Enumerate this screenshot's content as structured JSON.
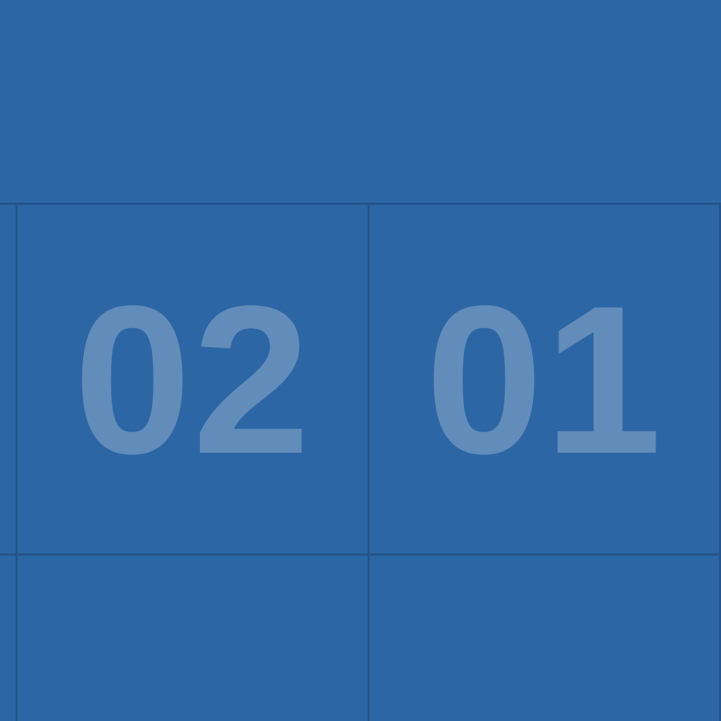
{
  "tiles": [
    {
      "number": "02"
    },
    {
      "number": "01"
    }
  ],
  "colors": {
    "background": "#2c66a5",
    "grid_line": "#24548a",
    "number": "#628cba"
  }
}
